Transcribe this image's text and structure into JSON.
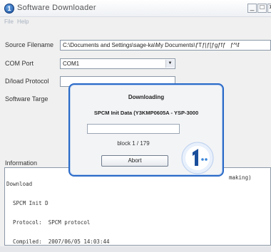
{
  "window": {
    "title": "Software Downloader",
    "app_icon_glyph": "1",
    "controls": {
      "minimize": "_",
      "maximize": "□",
      "close": "×"
    }
  },
  "menu": {
    "items": [
      "File",
      "Help"
    ]
  },
  "form": {
    "source_filename": {
      "label": "Source Filename",
      "value": "C:\\Documents and Settings\\sage-ka\\My Documents\\ƒTƒ|ƒ[ƒgƒfƒƒ^\\f"
    },
    "com_port": {
      "label": "COM Port",
      "value": "COM1"
    },
    "download_protocol": {
      "label": "D/load Protocol",
      "value": ""
    },
    "software_target": {
      "label": "Software Targe"
    }
  },
  "information": {
    "label": "Information",
    "lines": [
      "Download",
      "  SPCM Init D",
      "  Protocol:  SPCM protocol",
      "  Compiled:  2007/06/05 14:03:44"
    ],
    "partial_text_right": "making)"
  },
  "dialog": {
    "title": "Downloading",
    "subtitle": "SPCM Init Data (Y3KMP0605A - YSP-3000",
    "progress_fraction": 0.0,
    "block_status": "block 1 / 179",
    "abort_label": "Abort"
  },
  "colors": {
    "dialog_border": "#2a6ac8",
    "logo_blue": "#1b4f9c",
    "window_bg": "#f0f0f0"
  },
  "icons": {
    "app": "yamaha-one-logo-icon",
    "dialog_logo": "yamaha-one-logo-icon",
    "combo_arrow": "chevron-down-icon"
  }
}
